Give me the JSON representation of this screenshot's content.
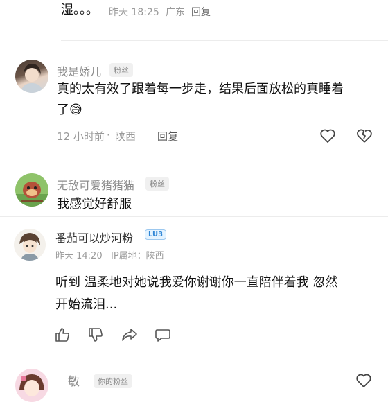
{
  "comments": [
    {
      "text": "湿。。。",
      "time": "昨天 18:25",
      "location": "广东",
      "reply_label": "回复"
    },
    {
      "username": "我是娇儿",
      "badge": "粉丝",
      "text_line1": "真的太有效了跟着每一步走，结果后面放松的真睡着",
      "text_line2": "了",
      "emoji": "😅",
      "time": "12 小时前",
      "location": "陕西",
      "reply_label": "回复"
    },
    {
      "username": "无敌可爱猪猪猫",
      "badge": "粉丝",
      "text": "我感觉好舒服"
    },
    {
      "username": "番茄可以炒河粉",
      "level_badge": "LU3",
      "time": "昨天 14:20",
      "ip_label": "IP属地：陕西",
      "text_line1": "听到 温柔地对她说我爱你谢谢你一直陪伴着我 忽然",
      "text_line2": "开始流泪..."
    },
    {
      "username": "敏",
      "badge": "你的粉丝"
    }
  ],
  "colors": {
    "heart_outline": "#444444",
    "meta_gray": "#9a9a9a",
    "divider": "#ececec"
  },
  "icons": [
    "heart-icon",
    "broken-heart-icon",
    "thumb-up-icon",
    "thumb-down-icon",
    "share-icon",
    "comment-icon"
  ]
}
